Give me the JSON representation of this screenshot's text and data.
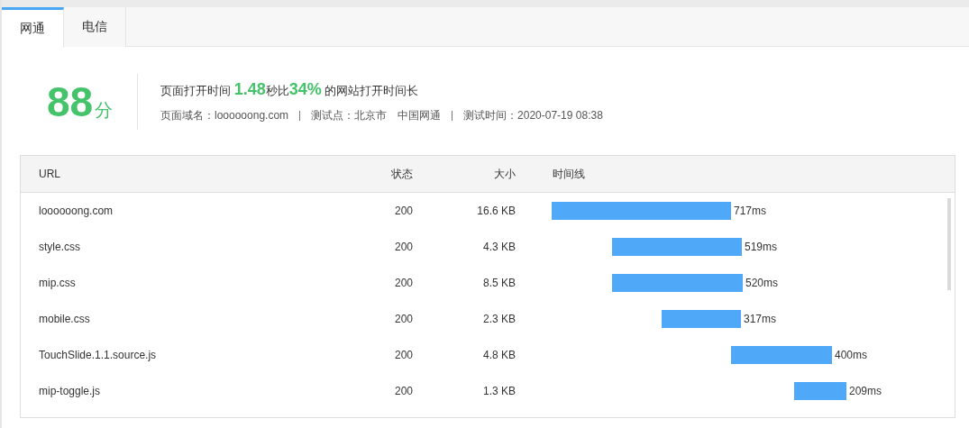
{
  "tabs": [
    {
      "label": "网通",
      "selected": true
    },
    {
      "label": "电信",
      "selected": false
    }
  ],
  "summary": {
    "score": "88",
    "score_unit": "分",
    "headline": "页面打开时间 **1.48**秒比**34%** 的网站打开时间长",
    "domain": "页面域名：loooooong.com",
    "location": "测试点：北京市　中国网通",
    "time": "测试时间：2020-07-19 08:38"
  },
  "table": {
    "columns": [
      "URL",
      "状态",
      "大小",
      "时间线"
    ],
    "rows": [
      {
        "url": "loooooong.com",
        "status": "200",
        "size": "16.6 KB",
        "timing": "717ms"
      },
      {
        "url": "style.css",
        "status": "200",
        "size": "4.3 KB",
        "timing": "519ms"
      },
      {
        "url": "mip.css",
        "status": "200",
        "size": "8.5 KB",
        "timing": "520ms"
      },
      {
        "url": "mobile.css",
        "status": "200",
        "size": "2.3 KB",
        "timing": "317ms"
      },
      {
        "url": "TouchSlide.1.1.source.js",
        "status": "200",
        "size": "4.8 KB",
        "timing": "400ms"
      },
      {
        "url": "mip-toggle.js",
        "status": "200",
        "size": "1.3 KB",
        "timing": "209ms"
      }
    ]
  }
}
